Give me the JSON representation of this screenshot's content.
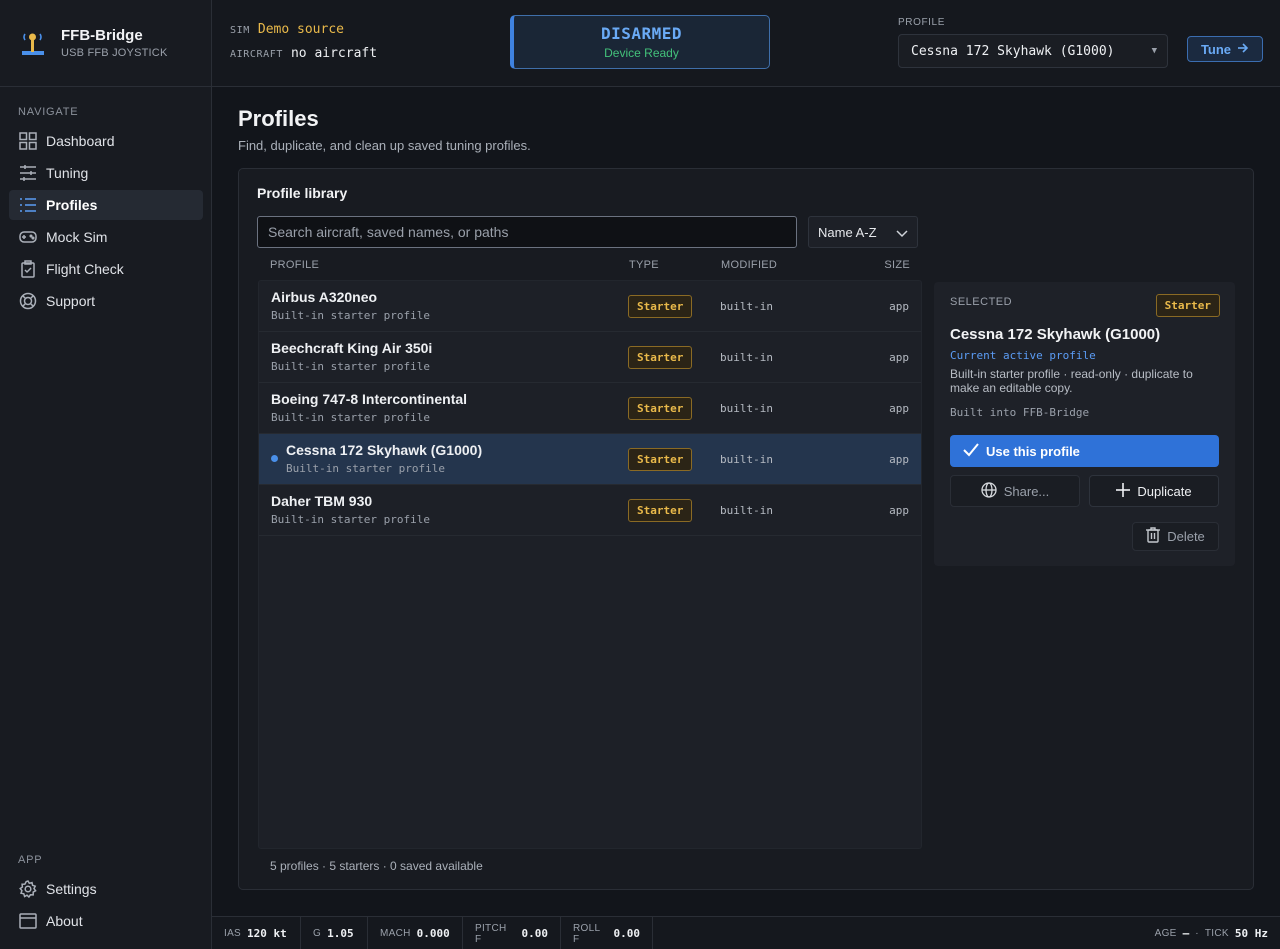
{
  "brand": {
    "name": "FFB-Bridge",
    "subtitle": "USB FFB JOYSTICK"
  },
  "sidebar": {
    "navigate_label": "NAVIGATE",
    "items": [
      {
        "label": "Dashboard",
        "icon": "dashboard-icon"
      },
      {
        "label": "Tuning",
        "icon": "sliders-icon"
      },
      {
        "label": "Profiles",
        "icon": "list-icon",
        "active": true
      },
      {
        "label": "Mock Sim",
        "icon": "gamepad-icon"
      },
      {
        "label": "Flight Check",
        "icon": "clipboard-check-icon"
      },
      {
        "label": "Support",
        "icon": "lifebuoy-icon"
      }
    ],
    "app_label": "APP",
    "app_items": [
      {
        "label": "Settings",
        "icon": "gear-icon"
      },
      {
        "label": "About",
        "icon": "window-icon"
      }
    ]
  },
  "header": {
    "sim_label": "SIM",
    "sim_value": "Demo source",
    "aircraft_label": "AIRCRAFT",
    "aircraft_value": "no aircraft",
    "status_main": "DISARMED",
    "status_sub": "Device Ready",
    "profile_label": "PROFILE",
    "profile_value": "Cessna 172 Skyhawk (G1000)",
    "tune_label": "Tune"
  },
  "page": {
    "title": "Profiles",
    "subtitle": "Find, duplicate, and clean up saved tuning profiles."
  },
  "library": {
    "title": "Profile library",
    "search_placeholder": "Search aircraft, saved names, or paths",
    "sort_value": "Name A-Z",
    "columns": {
      "profile": "PROFILE",
      "type": "TYPE",
      "modified": "MODIFIED",
      "size": "SIZE"
    },
    "rows": [
      {
        "name": "Airbus A320neo",
        "desc": "Built-in starter profile",
        "type": "Starter",
        "modified": "built-in",
        "size": "app"
      },
      {
        "name": "Beechcraft King Air 350i",
        "desc": "Built-in starter profile",
        "type": "Starter",
        "modified": "built-in",
        "size": "app"
      },
      {
        "name": "Boeing 747-8 Intercontinental",
        "desc": "Built-in starter profile",
        "type": "Starter",
        "modified": "built-in",
        "size": "app"
      },
      {
        "name": "Cessna 172 Skyhawk (G1000)",
        "desc": "Built-in starter profile",
        "type": "Starter",
        "modified": "built-in",
        "size": "app",
        "selected": true
      },
      {
        "name": "Daher TBM 930",
        "desc": "Built-in starter profile",
        "type": "Starter",
        "modified": "built-in",
        "size": "app"
      }
    ],
    "footer": "5 profiles · 5 starters · 0 saved available"
  },
  "detail": {
    "label": "SELECTED",
    "badge": "Starter",
    "name": "Cessna 172 Skyhawk (G1000)",
    "active_note": "Current active profile",
    "description": "Built-in starter profile · read-only · duplicate to make an editable copy.",
    "source": "Built into FFB-Bridge",
    "use_label": "Use this profile",
    "share_label": "Share...",
    "duplicate_label": "Duplicate",
    "delete_label": "Delete"
  },
  "statusbar": {
    "ias_label": "IAS",
    "ias_value": "120 kt",
    "g_label": "G",
    "g_value": "1.05",
    "mach_label": "MACH",
    "mach_value": "0.000",
    "pitch_label": "PITCH F",
    "pitch_value": "0.00",
    "roll_label": "ROLL F",
    "roll_value": "0.00",
    "age_label": "AGE",
    "age_value": "—",
    "sep": "·",
    "tick_label": "TICK",
    "tick_value": "50 Hz"
  },
  "colors": {
    "accent": "#2f72d8",
    "status_blue": "#6aaaf5",
    "ready_green": "#43c17a",
    "starter_amber": "#e9b94a"
  }
}
